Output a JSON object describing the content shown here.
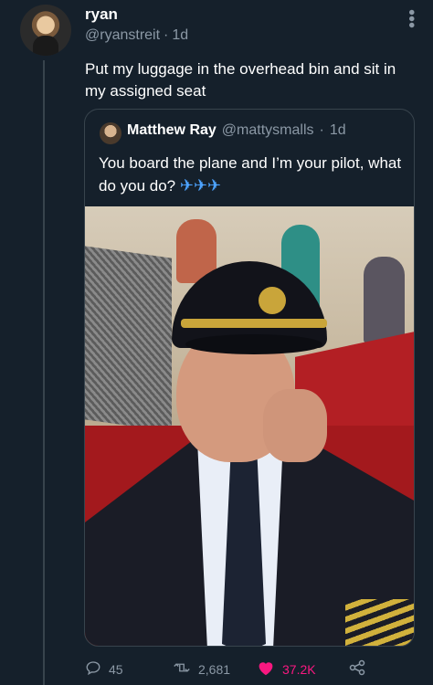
{
  "tweet": {
    "author_name": "ryan",
    "author_handle": "@ryanstreit",
    "separator": "·",
    "time": "1d",
    "text": "Put my luggage in the overhead bin and sit in my assigned seat"
  },
  "quoted_tweet": {
    "author_name": "Matthew Ray",
    "author_handle": "@mattysmalls",
    "separator": "·",
    "time": "1d",
    "text": "You board the plane and I’m your pilot, what do you do?",
    "emoji": "✈✈✈"
  },
  "actions": {
    "replies": "45",
    "retweets": "2,681",
    "likes": "37.2K"
  },
  "icons": {
    "more": "more-vertical-icon",
    "reply": "reply-icon",
    "retweet": "retweet-icon",
    "like": "heart-icon",
    "share": "share-icon"
  },
  "colors": {
    "background": "#15202b",
    "muted": "#8b98a5",
    "like": "#f91880",
    "border": "#38444d"
  }
}
